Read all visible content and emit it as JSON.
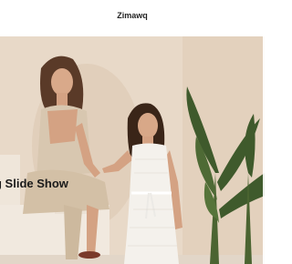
{
  "header": {
    "brand": "Zimawq"
  },
  "slideshow": {
    "current_slide": {
      "title": "g Slide Show",
      "image_description_icon": "photo-slide"
    }
  },
  "colors": {
    "background_wall": "#e7d8c6",
    "text": "#1a1a1a"
  }
}
